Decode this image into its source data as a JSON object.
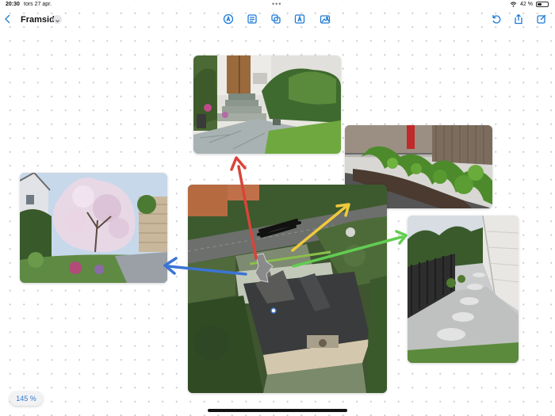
{
  "status_bar": {
    "time": "20:30",
    "date": "tors 27 apr.",
    "battery": "42 %",
    "battery_level": 0.42,
    "icons": [
      "wifi-icon",
      "battery-icon"
    ]
  },
  "toolbar": {
    "back_icon": "chevron-left-icon",
    "title": "Framsida",
    "title_menu_icon": "chevron-down-icon",
    "center_icons": [
      "pencil-markup-icon",
      "text-box-icon",
      "shapes-icon",
      "text-icon",
      "media-icon"
    ],
    "right_icons": [
      "undo-icon",
      "share-icon",
      "edit-icon"
    ],
    "accent_color": "#1e7bd6"
  },
  "canvas": {
    "images": [
      "front-door-steps-photo",
      "fence-planting-photo",
      "magnolia-garden-photo",
      "aerial-property-photo",
      "gravel-path-photo"
    ],
    "arrow_colors": {
      "red": "#d9443a",
      "yellow": "#f0c93c",
      "blue": "#3b74d6",
      "green": "#62cd52"
    }
  },
  "zoom": {
    "level": "145 %"
  }
}
